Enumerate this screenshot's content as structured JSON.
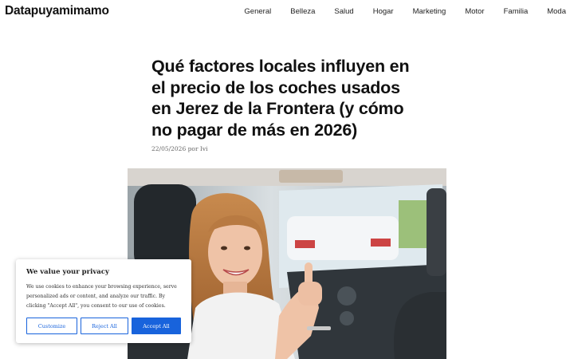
{
  "site": {
    "title": "Datapuyamimamo"
  },
  "nav": {
    "items": [
      "General",
      "Belleza",
      "Salud",
      "Hogar",
      "Marketing",
      "Motor",
      "Familia",
      "Moda"
    ]
  },
  "post": {
    "title": "Qué factores locales influyen en el precio de los coches usados en Jerez de la Frontera (y cómo no pagar de más en 2026)",
    "date": "22/05/2026",
    "by_label": "por",
    "author": "Ivi"
  },
  "cookie": {
    "title": "We value your privacy",
    "text": "We use cookies to enhance your browsing experience, serve personalized ads or content, and analyze our traffic. By clicking \"Accept All\", you consent to our use of cookies.",
    "customize_label": "Customize",
    "reject_label": "Reject All",
    "accept_label": "Accept All"
  },
  "colors": {
    "accent": "#1863dc"
  }
}
